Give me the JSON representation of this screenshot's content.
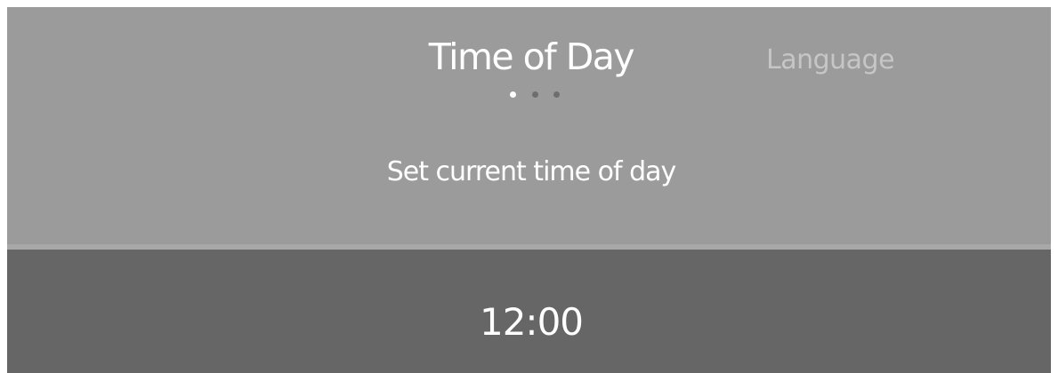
{
  "header": {
    "current_tab": "Time of Day",
    "next_tab": "Language",
    "page_indicator": {
      "total": 3,
      "active_index": 1
    },
    "subtitle": "Set current time of day"
  },
  "value": {
    "time": "12:00"
  },
  "colors": {
    "header_bg": "#9b9b9b",
    "value_bg": "#666666",
    "text_primary": "#ffffff",
    "text_inactive": "#c6c6c6",
    "dot_inactive": "#6e6e6e"
  }
}
